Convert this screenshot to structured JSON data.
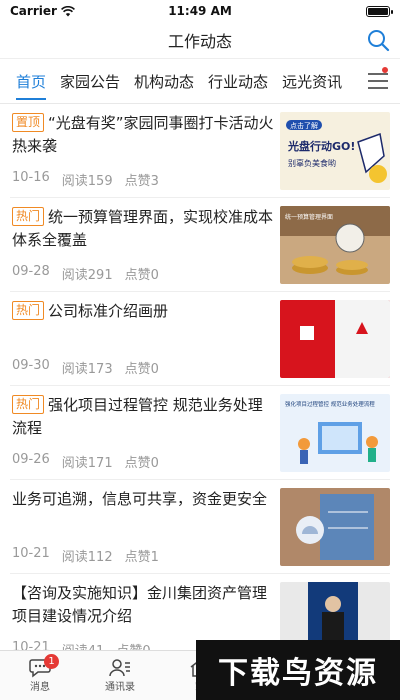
{
  "status": {
    "carrier": "Carrier",
    "time": "11:49 AM",
    "battery_level": 1.0
  },
  "header": {
    "title": "工作动态"
  },
  "tabs": [
    {
      "label": "首页",
      "active": true
    },
    {
      "label": "家园公告",
      "active": false
    },
    {
      "label": "机构动态",
      "active": false
    },
    {
      "label": "行业动态",
      "active": false
    },
    {
      "label": "远光资讯",
      "active": false
    }
  ],
  "articles": [
    {
      "badge": "置顶",
      "title": "“光盘有奖”家园同事圈打卡活动火热来袭",
      "date": "10-16",
      "reads": "阅读159",
      "likes": "点赞3",
      "thumb": {
        "t1": "点击了解",
        "t2": "光盘行动GO!",
        "t3": "别辜负美食哟"
      }
    },
    {
      "badge": "热门",
      "title": "统一预算管理界面，实现校准成本体系全覆盖",
      "date": "09-28",
      "reads": "阅读291",
      "likes": "点赞0",
      "thumb": {
        "t1": "统一预算管理界面"
      }
    },
    {
      "badge": "热门",
      "title": "公司标准介绍画册",
      "date": "09-30",
      "reads": "阅读173",
      "likes": "点赞0",
      "thumb": {}
    },
    {
      "badge": "热门",
      "title": "强化项目过程管控  规范业务处理流程",
      "date": "09-26",
      "reads": "阅读171",
      "likes": "点赞0",
      "thumb": {
        "t1": "强化项目过程管控  规范业务处理流程"
      }
    },
    {
      "badge": "",
      "title": "业务可追溯，信息可共享，资金更安全",
      "date": "10-21",
      "reads": "阅读112",
      "likes": "点赞1",
      "thumb": {}
    },
    {
      "badge": "",
      "title": "【咨询及实施知识】金川集团资产管理项目建设情况介绍",
      "date": "10-21",
      "reads": "阅读41",
      "likes": "点赞0",
      "thumb": {
        "t1": "金川集团资产"
      }
    }
  ],
  "tabbar": [
    {
      "label": "消息",
      "count": "1",
      "icon": "chat-icon"
    },
    {
      "label": "通讯录",
      "count": "",
      "icon": "contacts-icon"
    },
    {
      "label": "家",
      "count": "",
      "icon": "home-icon"
    }
  ],
  "watermark": {
    "text": "下载鸟资源"
  },
  "colors": {
    "accent": "#1f7fd8",
    "badge": "#f08a24",
    "red": "#e53935"
  }
}
